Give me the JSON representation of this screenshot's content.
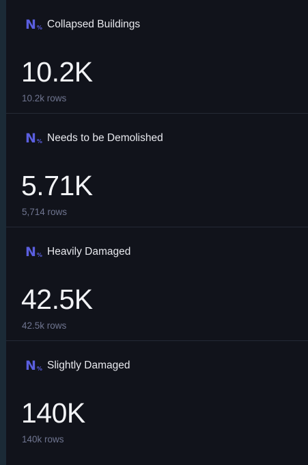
{
  "colors": {
    "background": "#11131b",
    "accent": "#5b5fe0",
    "title": "#e8e9ee",
    "value": "#f2f3f6",
    "subtext": "#6f7590"
  },
  "cards": [
    {
      "icon": "number-percent-icon",
      "title": "Collapsed Buildings",
      "value": "10.2K",
      "rows": "10.2k rows"
    },
    {
      "icon": "number-percent-icon",
      "title": "Needs to be Demolished",
      "value": "5.71K",
      "rows": "5,714 rows"
    },
    {
      "icon": "number-percent-icon",
      "title": "Heavily Damaged",
      "value": "42.5K",
      "rows": "42.5k rows"
    },
    {
      "icon": "number-percent-icon",
      "title": "Slightly Damaged",
      "value": "140K",
      "rows": "140k rows"
    }
  ]
}
